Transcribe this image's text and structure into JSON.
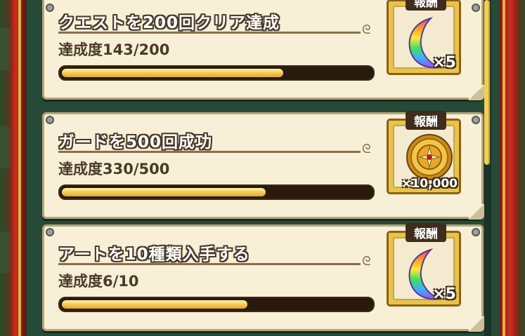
{
  "reward_label": "報酬",
  "quests": [
    {
      "title": "クエストを200回クリア達成",
      "progress_text": "達成度143/200",
      "progress": 0.715,
      "reward_icon": "rainbow-crescent-icon",
      "reward_count": "×5"
    },
    {
      "title": "ガードを500回成功",
      "progress_text": "達成度330/500",
      "progress": 0.66,
      "reward_icon": "gold-coin-icon",
      "reward_count": "×10,000"
    },
    {
      "title": "アートを10種類入手する",
      "progress_text": "達成度6/10",
      "progress": 0.6,
      "reward_icon": "rainbow-crescent-icon",
      "reward_count": "×5"
    }
  ],
  "colors": {
    "bar_fill": "#f4cf5a",
    "frame_red": "#c9301e",
    "card_bg": "#f7f0d6",
    "reward_gold": "#e9c34a"
  }
}
